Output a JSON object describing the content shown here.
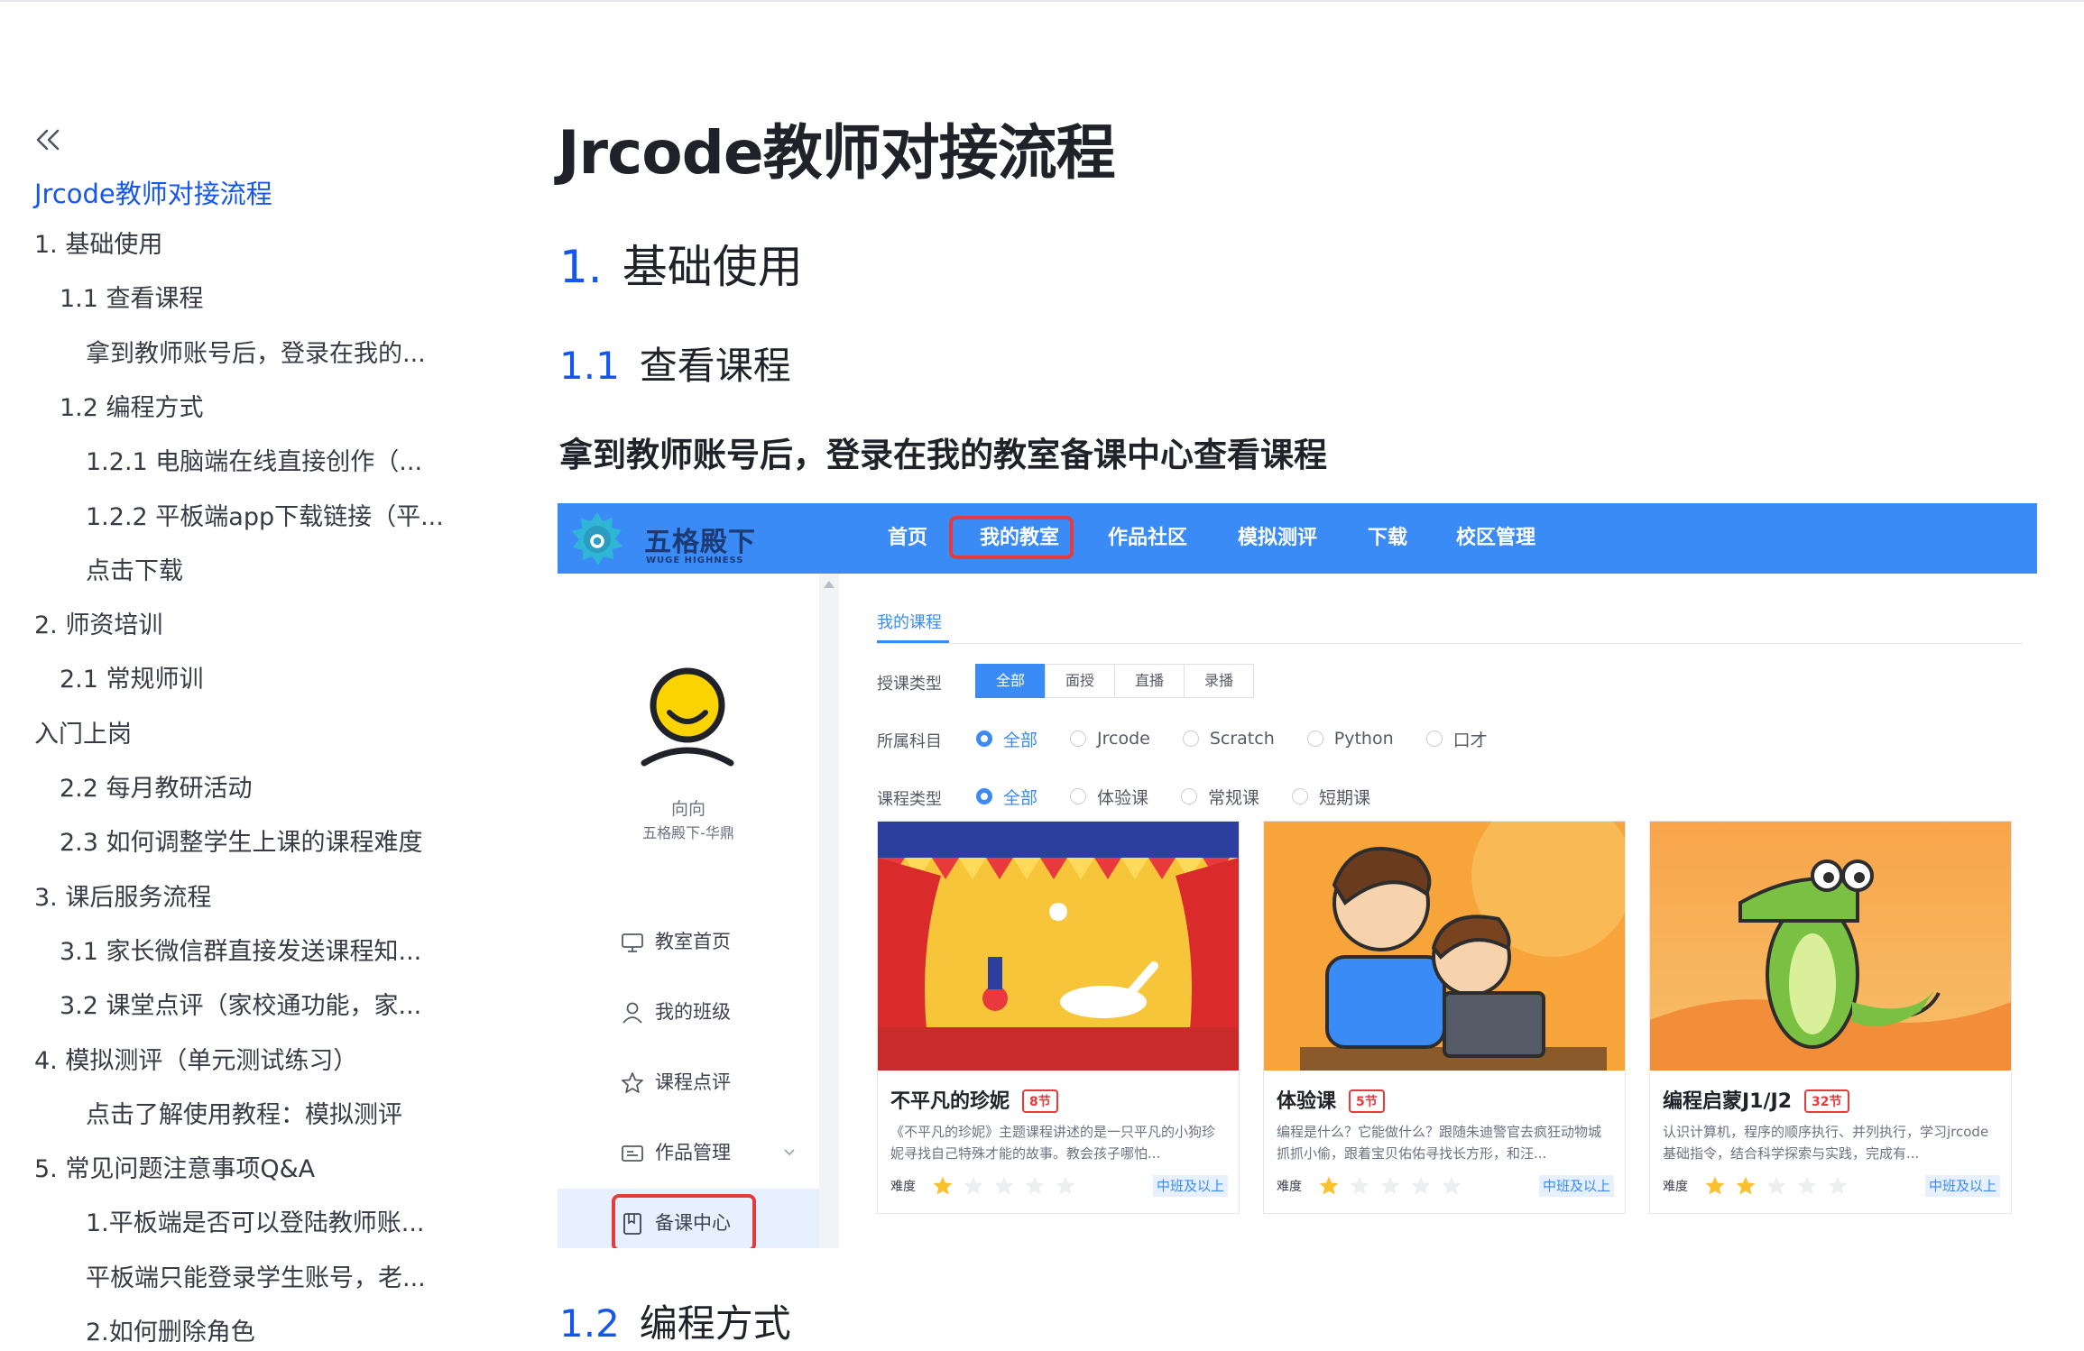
{
  "outline": {
    "collapse_icon": "double-chevron-left-icon",
    "title": "Jrcode教师对接流程",
    "items": [
      {
        "label": "1. 基础使用",
        "level": 1
      },
      {
        "label": "1.1 查看课程",
        "level": 2
      },
      {
        "label": "拿到教师账号后，登录在我的...",
        "level": 3
      },
      {
        "label": "1.2 编程方式",
        "level": 2
      },
      {
        "label": "1.2.1 电脑端在线直接创作（...",
        "level": 3
      },
      {
        "label": "1.2.2 平板端app下载链接（平...",
        "level": 3
      },
      {
        "label": "点击下载",
        "level": 3
      },
      {
        "label": "2. 师资培训",
        "level": 1
      },
      {
        "label": "2.1 常规师训",
        "level": 2
      },
      {
        "label": "入门上岗",
        "level": 1
      },
      {
        "label": "2.2 每月教研活动",
        "level": 2
      },
      {
        "label": "2.3 如何调整学生上课的课程难度",
        "level": 2
      },
      {
        "label": "3. 课后服务流程",
        "level": 1
      },
      {
        "label": "3.1 家长微信群直接发送课程知...",
        "level": 2
      },
      {
        "label": "3.2 课堂点评（家校通功能，家...",
        "level": 2
      },
      {
        "label": "4. 模拟测评（单元测试练习）",
        "level": 1
      },
      {
        "label": "点击了解使用教程：模拟测评",
        "level": 3
      },
      {
        "label": "5. 常见问题注意事项Q&A",
        "level": 1
      },
      {
        "label": "1.平板端是否可以登陆教师账...",
        "level": 3
      },
      {
        "label": "平板端只能登录学生账号，老...",
        "level": 3
      },
      {
        "label": "2.如何删除角色",
        "level": 3
      }
    ]
  },
  "doc": {
    "title": "Jrcode教师对接流程",
    "h1": {
      "num": "1.",
      "text": "基础使用"
    },
    "h2a": {
      "num": "1.1",
      "text": "查看课程"
    },
    "h3": "拿到教师账号后，登录在我的教室备课中心查看课程",
    "h2b": {
      "num": "1.2",
      "text": "编程方式"
    }
  },
  "screenshot": {
    "logo_name": "五格殿下",
    "logo_en": "WUGE HIGHNESS",
    "nav": [
      "首页",
      "我的教室",
      "作品社区",
      "模拟测评",
      "下载",
      "校区管理"
    ],
    "nav_highlight": "我的教室",
    "user_name": "向向",
    "user_org": "五格殿下-华鼎",
    "menu": [
      {
        "label": "教室首页",
        "icon": "monitor-icon"
      },
      {
        "label": "我的班级",
        "icon": "user-icon"
      },
      {
        "label": "课程点评",
        "icon": "star-outline-icon"
      },
      {
        "label": "作品管理",
        "icon": "card-icon"
      },
      {
        "label": "备课中心",
        "icon": "book-icon"
      }
    ],
    "menu_active": "备课中心",
    "tab": "我的课程",
    "filters": {
      "teach_type_label": "授课类型",
      "teach_type_options": [
        "全部",
        "面授",
        "直播",
        "录播"
      ],
      "subject_label": "所属科目",
      "subject_options": [
        "全部",
        "Jrcode",
        "Scratch",
        "Python",
        "口才"
      ],
      "course_type_label": "课程类型",
      "course_type_options": [
        "全部",
        "体验课",
        "常规课",
        "短期课"
      ]
    },
    "difficulty_label": "难度",
    "cards": [
      {
        "title": "不平凡的珍妮",
        "badge": "8节",
        "desc": "《不平凡的珍妮》主题课程讲述的是一只平凡的小狗珍妮寻找自己特殊才能的故事。教会孩子哪怕...",
        "stars": 1,
        "level": "中班及以上"
      },
      {
        "title": "体验课",
        "badge": "5节",
        "desc": "编程是什么？它能做什么？跟随朱迪警官去疯狂动物城抓抓小偷，跟着宝贝佑佑寻找长方形，和汪...",
        "stars": 1,
        "level": "中班及以上"
      },
      {
        "title": "编程启蒙J1/J2",
        "badge": "32节",
        "desc": "认识计算机，程序的顺序执行、并列执行，学习jrcode基础指令，结合科学探索与实践，完成有...",
        "stars": 2,
        "level": "中班及以上"
      }
    ],
    "colors": {
      "nav": "#3a8bf5",
      "highlight": "#e8393c",
      "accent": "#1456f0"
    }
  }
}
